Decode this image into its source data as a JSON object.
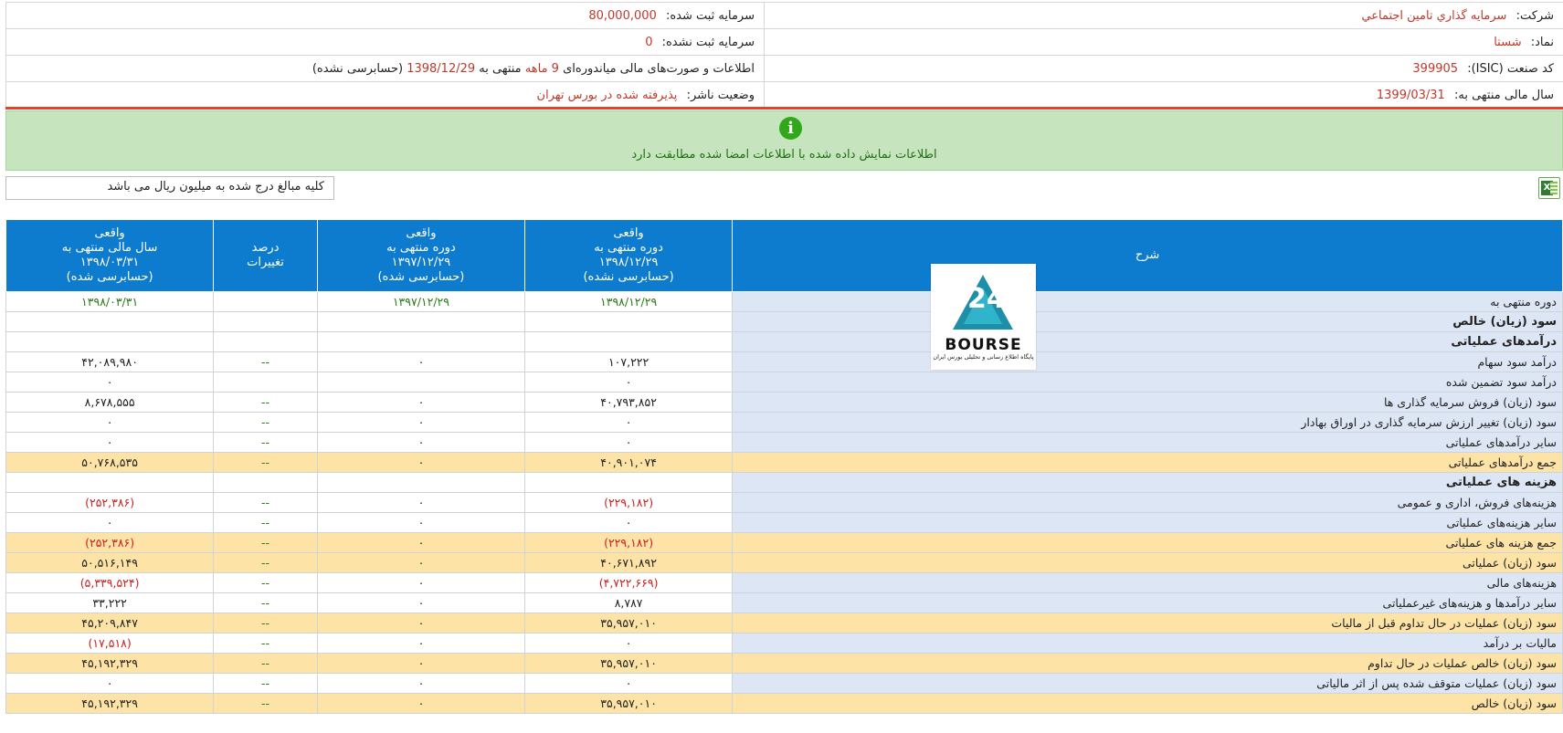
{
  "header": {
    "company_label": "شرکت:",
    "company_value": "سرمايه گذاري تامين اجتماعي",
    "registered_capital_label": "سرمایه ثبت شده:",
    "registered_capital_value": "80,000,000",
    "symbol_label": "نماد:",
    "symbol_value": "شستا",
    "unregistered_capital_label": "سرمایه ثبت نشده:",
    "unregistered_capital_value": "0",
    "isic_label": "کد صنعت (ISIC):",
    "isic_value": "399905",
    "report_prefix": "اطلاعات و صورت‌های مالی میاندوره‌ای",
    "report_months": "9 ماهه",
    "report_mid": "منتهی به",
    "report_date": "1398/12/29",
    "report_suffix": "(حسابرسی نشده)",
    "fiscal_year_label": "سال مالی منتهی به:",
    "fiscal_year_value": "1399/03/31",
    "publisher_status_label": "وضعیت ناشر:",
    "publisher_status_value": "پذیرفته شده در بورس تهران"
  },
  "notice": {
    "icon": "info-icon",
    "text": "اطلاعات نمایش داده شده با اطلاعات امضا شده مطابقت دارد"
  },
  "unit_note": "کلیه مبالغ درج شده به میلیون ریال می باشد",
  "excel_icon": "excel-export-icon",
  "logo": {
    "text": "BOURSE",
    "subtitle": "پایگاه اطلاع رسانی و تحلیلی بورس ایران"
  },
  "table": {
    "headers": {
      "desc": "شرح",
      "col1": [
        "واقعی",
        "دوره منتهی به",
        "۱۳۹۸/۱۲/۲۹",
        "(حسابرسی نشده)"
      ],
      "col2": [
        "واقعی",
        "دوره منتهی به",
        "۱۳۹۷/۱۲/۲۹",
        "(حسابرسی شده)"
      ],
      "col3": [
        "درصد",
        "تغییرات"
      ],
      "col4": [
        "واقعی",
        "سال مالی منتهی به",
        "۱۳۹۸/۰۳/۳۱",
        "(حسابرسی شده)"
      ]
    },
    "rows": [
      {
        "desc": "دوره منتهی به",
        "c1": "۱۳۹۸/۱۲/۲۹",
        "c2": "۱۳۹۷/۱۲/۲۹",
        "c3": "",
        "c4": "۱۳۹۸/۰۳/۳۱",
        "kind": "period"
      },
      {
        "desc": "سود (زیان) خالص",
        "c1": "",
        "c2": "",
        "c3": "",
        "c4": "",
        "kind": "bold"
      },
      {
        "desc": "درآمدهای عملیاتی",
        "c1": "",
        "c2": "",
        "c3": "",
        "c4": "",
        "kind": "bold"
      },
      {
        "desc": "درآمد سود سهام",
        "c1": "۱۰۷,۲۲۲",
        "c2": "۰",
        "c3": "--",
        "c4": "۴۲,۰۸۹,۹۸۰",
        "kind": "normal"
      },
      {
        "desc": "درآمد سود تضمین شده",
        "c1": "۰",
        "c2": "",
        "c3": "",
        "c4": "۰",
        "kind": "normal"
      },
      {
        "desc": "سود (زیان) فروش سرمایه گذاری ها",
        "c1": "۴۰,۷۹۳,۸۵۲",
        "c2": "۰",
        "c3": "--",
        "c4": "۸,۶۷۸,۵۵۵",
        "kind": "normal"
      },
      {
        "desc": "سود (زیان) تغییر ارزش سرمایه گذاری در اوراق بهادار",
        "c1": "۰",
        "c2": "۰",
        "c3": "--",
        "c4": "۰",
        "kind": "normal"
      },
      {
        "desc": "سایر درآمدهای عملیاتی",
        "c1": "۰",
        "c2": "۰",
        "c3": "--",
        "c4": "۰",
        "kind": "normal"
      },
      {
        "desc": "جمع درآمدهای عملیاتی",
        "c1": "۴۰,۹۰۱,۰۷۴",
        "c2": "۰",
        "c3": "--",
        "c4": "۵۰,۷۶۸,۵۳۵",
        "kind": "total"
      },
      {
        "desc": "هزینه های عملیاتی",
        "c1": "",
        "c2": "",
        "c3": "",
        "c4": "",
        "kind": "bold"
      },
      {
        "desc": "هزینه‌های فروش، اداری و عمومی",
        "c1": "(۲۲۹,۱۸۲)",
        "c2": "۰",
        "c3": "--",
        "c4": "(۲۵۲,۳۸۶)",
        "kind": "normal"
      },
      {
        "desc": "سایر هزینه‌های عملیاتی",
        "c1": "۰",
        "c2": "۰",
        "c3": "--",
        "c4": "۰",
        "kind": "normal"
      },
      {
        "desc": "جمع هزینه های عملیاتی",
        "c1": "(۲۲۹,۱۸۲)",
        "c2": "۰",
        "c3": "--",
        "c4": "(۲۵۲,۳۸۶)",
        "kind": "total"
      },
      {
        "desc": "سود (زیان) عملیاتی",
        "c1": "۴۰,۶۷۱,۸۹۲",
        "c2": "۰",
        "c3": "--",
        "c4": "۵۰,۵۱۶,۱۴۹",
        "kind": "total"
      },
      {
        "desc": "هزینه‌های مالی",
        "c1": "(۴,۷۲۲,۶۶۹)",
        "c2": "۰",
        "c3": "--",
        "c4": "(۵,۳۳۹,۵۲۴)",
        "kind": "normal"
      },
      {
        "desc": "سایر درآمدها و هزینه‌های غیرعملیاتی",
        "c1": "۸,۷۸۷",
        "c2": "۰",
        "c3": "--",
        "c4": "۳۳,۲۲۲",
        "kind": "normal"
      },
      {
        "desc": "سود (زیان) عملیات در حال تداوم قبل از مالیات",
        "c1": "۳۵,۹۵۷,۰۱۰",
        "c2": "۰",
        "c3": "--",
        "c4": "۴۵,۲۰۹,۸۴۷",
        "kind": "total"
      },
      {
        "desc": "مالیات بر درآمد",
        "c1": "۰",
        "c2": "۰",
        "c3": "--",
        "c4": "(۱۷,۵۱۸)",
        "kind": "normal"
      },
      {
        "desc": "سود (زیان) خالص عملیات در حال تداوم",
        "c1": "۳۵,۹۵۷,۰۱۰",
        "c2": "۰",
        "c3": "--",
        "c4": "۴۵,۱۹۲,۳۲۹",
        "kind": "total"
      },
      {
        "desc": "سود (زیان) عملیات متوقف شده پس از اثر مالیاتی",
        "c1": "۰",
        "c2": "۰",
        "c3": "--",
        "c4": "۰",
        "kind": "normal"
      },
      {
        "desc": "سود (زیان) خالص",
        "c1": "۳۵,۹۵۷,۰۱۰",
        "c2": "۰",
        "c3": "--",
        "c4": "۴۵,۱۹۲,۳۲۹",
        "kind": "total"
      }
    ]
  }
}
